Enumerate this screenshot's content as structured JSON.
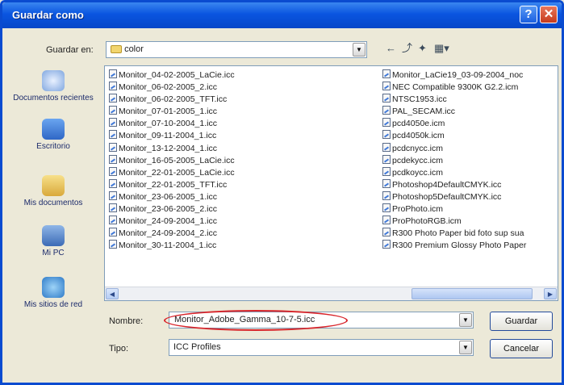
{
  "window": {
    "title": "Guardar como",
    "help_label": "?",
    "close_label": "✕"
  },
  "save_in": {
    "label": "Guardar en:",
    "value": "color"
  },
  "toolbar": {
    "back_icon": "back-arrow-icon",
    "up_icon": "up-folder-icon",
    "new_folder_icon": "new-folder-icon",
    "view_icon": "view-menu-icon"
  },
  "places": [
    {
      "label": "Documentos recientes",
      "icon": "recent-documents-icon"
    },
    {
      "label": "Escritorio",
      "icon": "desktop-icon"
    },
    {
      "label": "Mis documentos",
      "icon": "my-documents-icon"
    },
    {
      "label": "Mi PC",
      "icon": "my-computer-icon"
    },
    {
      "label": "Mis sitios de red",
      "icon": "network-places-icon"
    }
  ],
  "files_left": [
    "Monitor_04-02-2005_LaCie.icc",
    "Monitor_06-02-2005_2.icc",
    "Monitor_06-02-2005_TFT.icc",
    "Monitor_07-01-2005_1.icc",
    "Monitor_07-10-2004_1.icc",
    "Monitor_09-11-2004_1.icc",
    "Monitor_13-12-2004_1.icc",
    "Monitor_16-05-2005_LaCie.icc",
    "Monitor_22-01-2005_LaCie.icc",
    "Monitor_22-01-2005_TFT.icc",
    "Monitor_23-06-2005_1.icc",
    "Monitor_23-06-2005_2.icc",
    "Monitor_24-09-2004_1.icc",
    "Monitor_24-09-2004_2.icc",
    "Monitor_30-11-2004_1.icc"
  ],
  "files_right": [
    "Monitor_LaCie19_03-09-2004_noc",
    "NEC Compatible 9300K G2.2.icm",
    "NTSC1953.icc",
    "PAL_SECAM.icc",
    "pcd4050e.icm",
    "pcd4050k.icm",
    "pcdcnycc.icm",
    "pcdekycc.icm",
    "pcdkoycc.icm",
    "Photoshop4DefaultCMYK.icc",
    "Photoshop5DefaultCMYK.icc",
    "ProPhoto.icm",
    "ProPhotoRGB.icm",
    "R300 Photo Paper bid foto sup sua",
    "R300 Premium Glossy Photo Paper"
  ],
  "filename": {
    "label": "Nombre:",
    "value": "Monitor_Adobe_Gamma_10-7-5.icc"
  },
  "filetype": {
    "label": "Tipo:",
    "value": "ICC Profiles"
  },
  "buttons": {
    "save": "Guardar",
    "cancel": "Cancelar"
  },
  "colors": {
    "titlebar": "#0a55e0",
    "highlight": "#d8242a"
  }
}
